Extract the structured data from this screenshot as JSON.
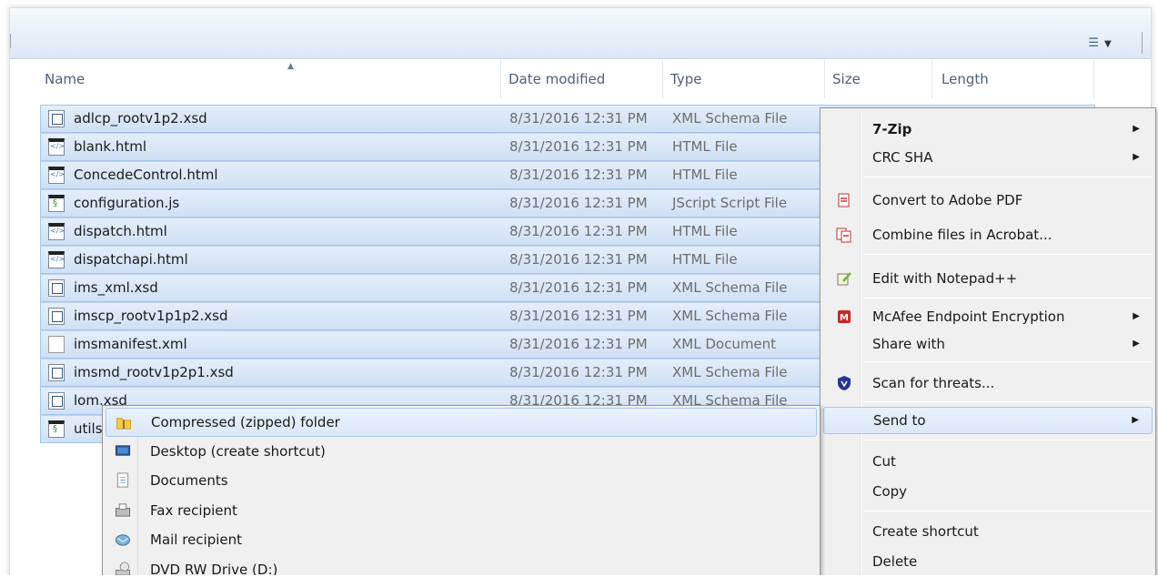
{
  "columns": {
    "name": "Name",
    "date": "Date modified",
    "type": "Type",
    "size": "Size",
    "length": "Length"
  },
  "files": [
    {
      "name": "adlcp_rootv1p2.xsd",
      "date": "8/31/2016 12:31 PM",
      "type": "XML Schema File",
      "icon": "xsd-file-icon"
    },
    {
      "name": "blank.html",
      "date": "8/31/2016 12:31 PM",
      "type": "HTML File",
      "icon": "html-file-icon"
    },
    {
      "name": "ConcedeControl.html",
      "date": "8/31/2016 12:31 PM",
      "type": "HTML File",
      "icon": "html-file-icon"
    },
    {
      "name": "configuration.js",
      "date": "8/31/2016 12:31 PM",
      "type": "JScript Script File",
      "icon": "js-file-icon"
    },
    {
      "name": "dispatch.html",
      "date": "8/31/2016 12:31 PM",
      "type": "HTML File",
      "icon": "html-file-icon"
    },
    {
      "name": "dispatchapi.html",
      "date": "8/31/2016 12:31 PM",
      "type": "HTML File",
      "icon": "html-file-icon"
    },
    {
      "name": "ims_xml.xsd",
      "date": "8/31/2016 12:31 PM",
      "type": "XML Schema File",
      "icon": "xsd-file-icon"
    },
    {
      "name": "imscp_rootv1p1p2.xsd",
      "date": "8/31/2016 12:31 PM",
      "type": "XML Schema File",
      "icon": "xsd-file-icon"
    },
    {
      "name": "imsmanifest.xml",
      "date": "8/31/2016 12:31 PM",
      "type": "XML Document",
      "icon": "xml-file-icon"
    },
    {
      "name": "imsmd_rootv1p2p1.xsd",
      "date": "8/31/2016 12:31 PM",
      "type": "XML Schema File",
      "icon": "xsd-file-icon"
    },
    {
      "name": "lom.xsd",
      "date": "8/31/2016 12:31 PM",
      "type": "XML Schema File",
      "icon": "xsd-file-icon"
    },
    {
      "name": "utils",
      "date": "",
      "type": "",
      "icon": "js-file-icon"
    }
  ],
  "context_menu": {
    "seven_zip": "7-Zip",
    "crc_sha": "CRC SHA",
    "convert_pdf": "Convert to Adobe PDF",
    "combine_acrobat": "Combine files in Acrobat...",
    "notepad": "Edit with Notepad++",
    "mcafee": "McAfee Endpoint Encryption",
    "share_with": "Share with",
    "scan": "Scan for threats...",
    "send_to": "Send to",
    "cut": "Cut",
    "copy": "Copy",
    "create_shortcut": "Create shortcut",
    "delete": "Delete",
    "submenu_arrow": "▶"
  },
  "send_to_menu": {
    "zipped": "Compressed (zipped) folder",
    "desktop": "Desktop (create shortcut)",
    "documents": "Documents",
    "fax": "Fax recipient",
    "mail": "Mail recipient",
    "dvd": "DVD RW Drive (D:)"
  },
  "colors": {
    "selection": "#cfe0f5",
    "selection_border": "#a7c4e9",
    "menu_bg": "#f0f0f0",
    "header_text": "#4c607a"
  }
}
